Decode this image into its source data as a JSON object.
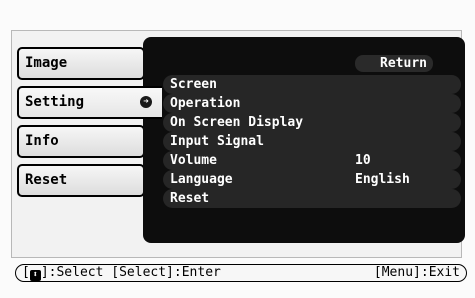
{
  "left_menu": {
    "items": [
      {
        "label": "Image"
      },
      {
        "label": "Setting"
      },
      {
        "label": "Info"
      },
      {
        "label": "Reset"
      }
    ],
    "selected": "Setting",
    "selected_arrow": "➜"
  },
  "panel": {
    "return_label": "Return",
    "rows": [
      {
        "label": "Screen",
        "value": ""
      },
      {
        "label": "Operation",
        "value": ""
      },
      {
        "label": "On Screen Display",
        "value": ""
      },
      {
        "label": "Input Signal",
        "value": ""
      },
      {
        "label": "Volume",
        "value": "10"
      },
      {
        "label": "Language",
        "value": "English"
      },
      {
        "label": "Reset",
        "value": ""
      }
    ]
  },
  "status": {
    "updown_icon": "⬍",
    "left_text_prefix": "[",
    "left_text_suffix": "]:Select [Select]:Enter",
    "right_text": "[Menu]:Exit"
  }
}
